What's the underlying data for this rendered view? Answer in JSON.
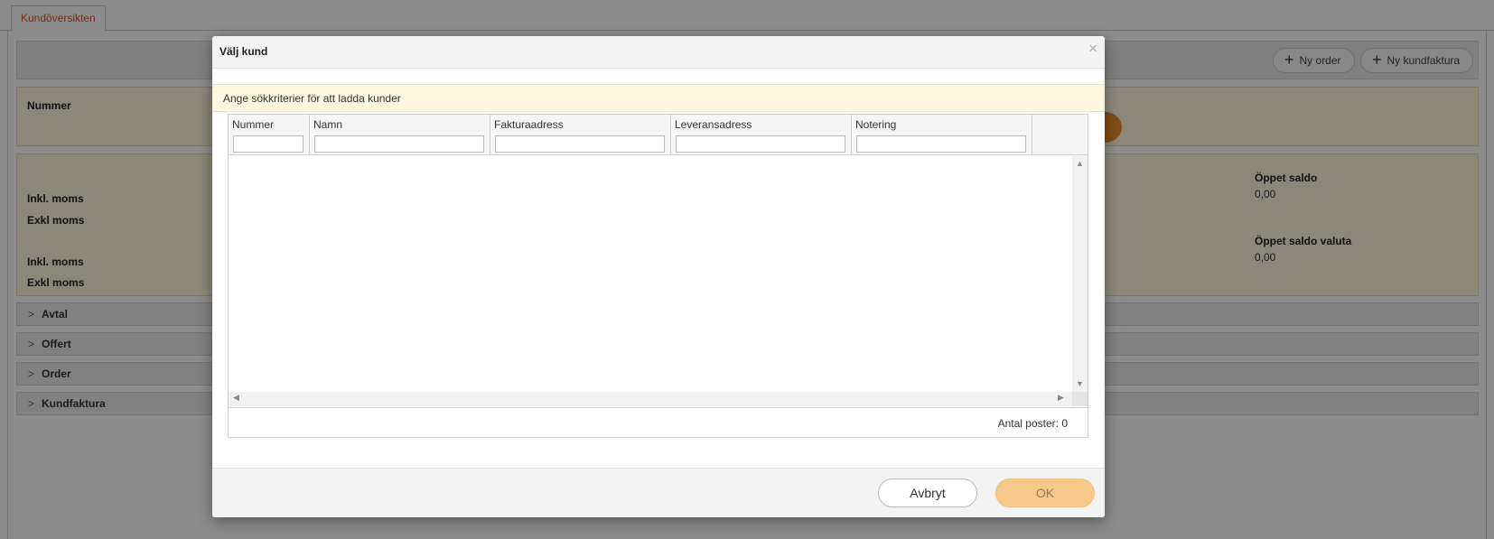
{
  "background": {
    "tab_label": "Kundöversikten",
    "toolbar": {
      "new_order": "Ny order",
      "new_invoice": "Ny kundfaktura"
    },
    "info_panel": {
      "number_label": "Nummer"
    },
    "summary": {
      "incl_vat_1": "Inkl. moms",
      "excl_vat_1": "Exkl moms",
      "incl_vat_2": "Inkl. moms",
      "excl_vat_2": "Exkl moms",
      "open_balance_label": "Öppet saldo",
      "open_balance_value": "0,00",
      "open_balance_currency_label": "Öppet saldo valuta",
      "open_balance_currency_value": "0,00"
    },
    "sections": [
      "Avtal",
      "Offert",
      "Order",
      "Kundfaktura"
    ]
  },
  "modal": {
    "title": "Välj kund",
    "close_glyph": "×",
    "notice": "Ange sökkriterier för att ladda kunder",
    "columns": [
      "Nummer",
      "Namn",
      "Fakturaadress",
      "Leveransadress",
      "Notering"
    ],
    "footer_count": "Antal poster: 0",
    "cancel_label": "Avbryt",
    "ok_label": "OK"
  },
  "colors": {
    "accent_orange": "#e98a2c",
    "ok_button": "#f6c98a",
    "notice_bg": "#fdf8dd",
    "tab_text": "#c8562e"
  }
}
